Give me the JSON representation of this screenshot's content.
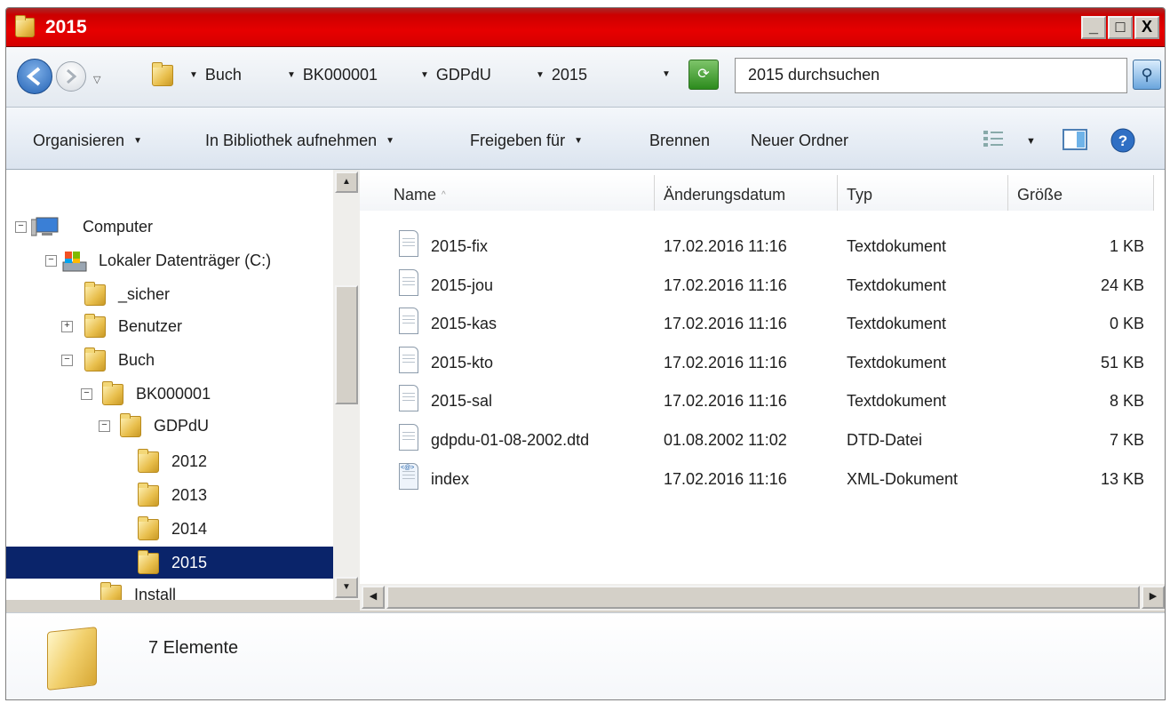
{
  "window": {
    "title": "2015",
    "min": "_",
    "max": "□",
    "close": "X"
  },
  "address": {
    "crumbs": [
      "Buch",
      "BK000001",
      "GDPdU",
      "2015"
    ],
    "search_placeholder": "2015 durchsuchen"
  },
  "toolbar": {
    "organize": "Organisieren",
    "include": "In Bibliothek aufnehmen",
    "share": "Freigeben für",
    "burn": "Brennen",
    "new_folder": "Neuer Ordner"
  },
  "tree": [
    {
      "label": "Computer",
      "exp": "−",
      "icon": "computer-icon"
    },
    {
      "label": "Lokaler Datenträger (C:)",
      "exp": "−",
      "icon": "drive-icon"
    },
    {
      "label": "_sicher",
      "exp": "",
      "icon": "folder-icon"
    },
    {
      "label": "Benutzer",
      "exp": "+",
      "icon": "folder-icon"
    },
    {
      "label": "Buch",
      "exp": "−",
      "icon": "folder-icon"
    },
    {
      "label": "BK000001",
      "exp": "−",
      "icon": "folder-icon"
    },
    {
      "label": "GDPdU",
      "exp": "−",
      "icon": "folder-icon"
    },
    {
      "label": "2012",
      "exp": "",
      "icon": "folder-icon"
    },
    {
      "label": "2013",
      "exp": "",
      "icon": "folder-icon"
    },
    {
      "label": "2014",
      "exp": "",
      "icon": "folder-icon"
    },
    {
      "label": "2015",
      "exp": "",
      "icon": "folder-icon",
      "selected": true
    },
    {
      "label": "Install",
      "exp": "",
      "icon": "folder-icon"
    }
  ],
  "columns": {
    "name": "Name",
    "date": "Änderungsdatum",
    "type": "Typ",
    "size": "Größe"
  },
  "files": [
    {
      "name": "2015-fix",
      "date": "17.02.2016 11:16",
      "type": "Textdokument",
      "size": "1 KB",
      "icon": "text-file-icon"
    },
    {
      "name": "2015-jou",
      "date": "17.02.2016 11:16",
      "type": "Textdokument",
      "size": "24 KB",
      "icon": "text-file-icon"
    },
    {
      "name": "2015-kas",
      "date": "17.02.2016 11:16",
      "type": "Textdokument",
      "size": "0 KB",
      "icon": "text-file-icon"
    },
    {
      "name": "2015-kto",
      "date": "17.02.2016 11:16",
      "type": "Textdokument",
      "size": "51 KB",
      "icon": "text-file-icon"
    },
    {
      "name": "2015-sal",
      "date": "17.02.2016 11:16",
      "type": "Textdokument",
      "size": "8 KB",
      "icon": "text-file-icon"
    },
    {
      "name": "gdpdu-01-08-2002.dtd",
      "date": "01.08.2002 11:02",
      "type": "DTD-Datei",
      "size": "7 KB",
      "icon": "dtd-file-icon"
    },
    {
      "name": "index",
      "date": "17.02.2016 11:16",
      "type": "XML-Dokument",
      "size": "13 KB",
      "icon": "xml-file-icon"
    }
  ],
  "status": {
    "count": "7 Elemente"
  }
}
